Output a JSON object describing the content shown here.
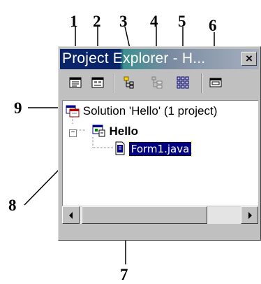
{
  "window": {
    "title": "Project Explorer - H...",
    "close_symbol": "×"
  },
  "callouts": [
    "1",
    "2",
    "3",
    "4",
    "5",
    "6",
    "7",
    "8",
    "9"
  ],
  "toolbar": {
    "buttons": [
      {
        "icon": "view-code-icon"
      },
      {
        "icon": "view-designer-icon"
      },
      {
        "icon": "add-item-icon"
      },
      {
        "icon": "tree-view-icon"
      },
      {
        "icon": "package-view-icon"
      },
      {
        "icon": "properties-icon"
      }
    ]
  },
  "tree": {
    "solution_label": "Solution 'Hello' (1 project)",
    "project_label": "Hello",
    "file_label": "Form1.java",
    "expander_symbol": "−"
  },
  "colors": {
    "title_active": "#0a246a",
    "selection": "#000080",
    "window_face": "#c0c0c0"
  }
}
